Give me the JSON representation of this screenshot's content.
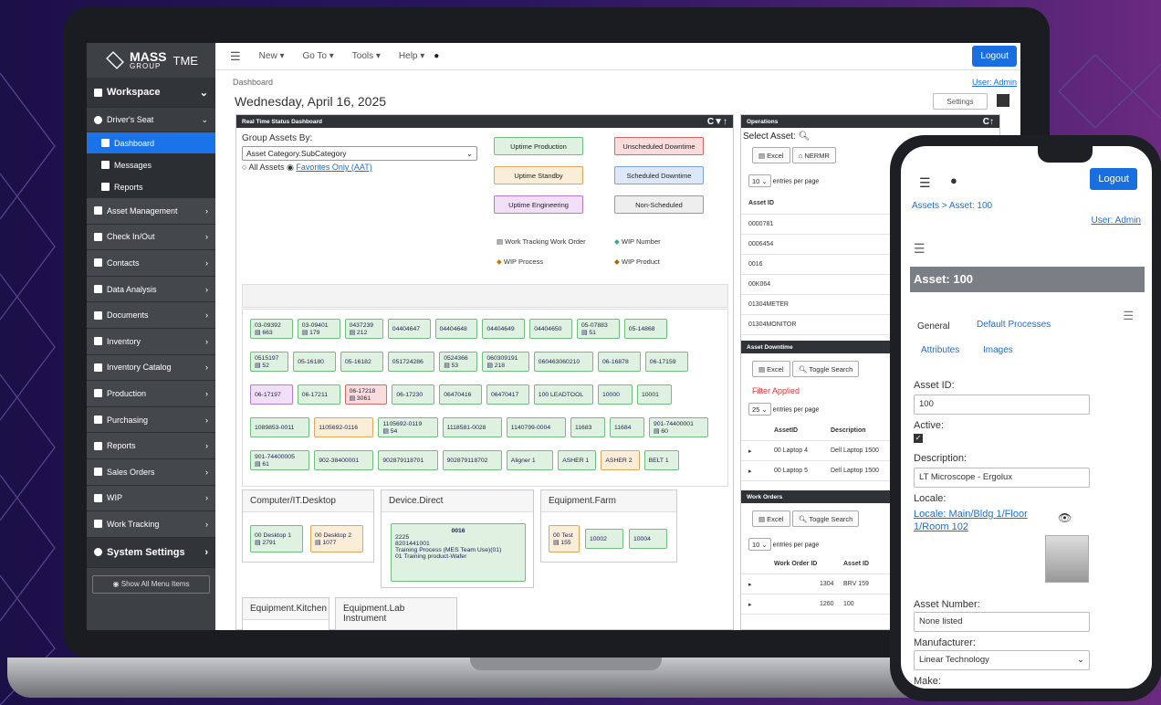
{
  "brand": {
    "name": "MASS",
    "sub": "GROUP",
    "product": "TME"
  },
  "top": {
    "menu": [
      "New ▾",
      "Go To ▾",
      "Tools ▾",
      "Help ▾"
    ],
    "logout": "Logout",
    "breadcrumb": "Dashboard",
    "user": "User: Admin",
    "date": "Wednesday, April 16, 2025",
    "settings": "Settings"
  },
  "sidebar": {
    "workspace": "Workspace",
    "drivers_seat": "Driver's Seat",
    "subs": [
      "Dashboard",
      "Messages",
      "Reports"
    ],
    "items": [
      "Asset Management",
      "Check In/Out",
      "Contacts",
      "Data Analysis",
      "Documents",
      "Inventory",
      "Inventory Catalog",
      "Production",
      "Purchasing",
      "Reports",
      "Sales Orders",
      "WIP",
      "Work Tracking"
    ],
    "system": "System Settings",
    "show_all": "Show All Menu Items"
  },
  "rts": {
    "title": "Real Time Status Dashboard",
    "group_label": "Group Assets By:",
    "group_value": "Asset Category.SubCategory",
    "all_assets": "All Assets",
    "favorites": "Favorites Only (AAT)",
    "legend": [
      "Uptime Production",
      "Unscheduled Downtime",
      "Uptime Standby",
      "Scheduled Downtime",
      "Uptime Engineering",
      "Non-Scheduled"
    ],
    "legend2": [
      "Work Tracking Work Order",
      "WIP Number",
      "WIP Process",
      "WIP Product"
    ],
    "tiles": [
      [
        "03-09392",
        "663"
      ],
      [
        "03-09401",
        "179"
      ],
      [
        "0437239",
        "212"
      ],
      [
        "04404647",
        ""
      ],
      [
        "04404648",
        ""
      ],
      [
        "04404649",
        ""
      ],
      [
        "04404650",
        ""
      ],
      [
        "05-07883",
        "51"
      ],
      [
        "05-14868",
        ""
      ],
      [
        "0515197",
        "52"
      ],
      [
        "05-16180",
        ""
      ],
      [
        "05-16182",
        ""
      ],
      [
        "051724286",
        ""
      ],
      [
        "0524366",
        "53"
      ],
      [
        "060309191",
        "218"
      ],
      [
        "060463060210",
        ""
      ],
      [
        "06-16878",
        ""
      ],
      [
        "06-17159",
        ""
      ],
      [
        "06-17197",
        ""
      ],
      [
        "06-17211",
        ""
      ],
      [
        "06-17218",
        "3061"
      ],
      [
        "06-17230",
        ""
      ],
      [
        "06470416",
        ""
      ],
      [
        "06470417",
        ""
      ],
      [
        "100 LEADTOOL",
        ""
      ],
      [
        "10000",
        ""
      ],
      [
        "10001",
        ""
      ],
      [
        "1089853-0011",
        ""
      ],
      [
        "1105692-0116",
        ""
      ],
      [
        "1105692-0119",
        "54"
      ],
      [
        "1118581-0028",
        ""
      ],
      [
        "1140799-0004",
        ""
      ],
      [
        "11683",
        ""
      ],
      [
        "11684",
        ""
      ],
      [
        "901-74400001",
        "60"
      ],
      [
        "901-74400005",
        "61"
      ],
      [
        "902-38400001",
        ""
      ],
      [
        "902879118701",
        ""
      ],
      [
        "902879118702",
        ""
      ],
      [
        "Aligner 1",
        ""
      ],
      [
        "ASHER 1",
        ""
      ],
      [
        "ASHER 2",
        ""
      ],
      [
        "BELT 1",
        ""
      ]
    ],
    "groups": [
      "Computer/IT.Desktop",
      "Device.Direct",
      "Equipment.Farm",
      "Equipment.Kitchen",
      "Equipment.Lab Instrument"
    ],
    "g1": [
      [
        "00 Desktop 1",
        "2791"
      ],
      [
        "00 Desktop 2",
        "1077"
      ]
    ],
    "g2": {
      "name": "0016",
      "lines": [
        "2225",
        "8201441001",
        "Training Process (MES Team Use)(01)",
        "01 Training product-Wafer"
      ]
    },
    "g3": [
      [
        "00 Test",
        "155"
      ],
      [
        "10002",
        ""
      ],
      [
        "10004",
        ""
      ]
    ]
  },
  "ops": {
    "title": "Operations",
    "select_asset": "Select Asset:",
    "excel": "Excel",
    "nermr": "NERMR",
    "entries": "entries per page",
    "per_page": "10",
    "asset_id": "Asset ID",
    "assets": [
      "0000781",
      "0006454",
      "0016",
      "00K064",
      "01304METER",
      "01304MONITOR"
    ],
    "downtime_title": "Asset Downtime",
    "toggle": "Toggle Search",
    "filter": "Filter Applied",
    "per_page2": "25",
    "cols": [
      "AssetID",
      "Description"
    ],
    "dt_rows": [
      [
        "00 Laptop 4",
        "Dell Laptop 1500"
      ],
      [
        "00 Laptop 5",
        "Dell Laptop 1500"
      ]
    ],
    "wo_title": "Work Orders",
    "wo_cols": [
      "Work Order ID",
      "Asset ID"
    ],
    "wo_rows": [
      [
        "1304",
        "BRV 159"
      ],
      [
        "1260",
        "100"
      ]
    ]
  },
  "phone": {
    "logout": "Logout",
    "crumb": "Assets > Asset: 100",
    "user": "User: Admin",
    "header": "Asset: 100",
    "tabs": [
      "General",
      "Default Processes",
      "Attributes",
      "Images"
    ],
    "asset_id_label": "Asset ID:",
    "asset_id": "100",
    "active_label": "Active:",
    "desc_label": "Description:",
    "desc": "LT Microscope - Ergolux",
    "locale_label": "Locale:",
    "locale": "Locale: Main/Bldg 1/Floor 1/Room 102",
    "asset_num_label": "Asset Number:",
    "asset_num": "None listed",
    "mfr_label": "Manufacturer:",
    "mfr": "Linear Technology",
    "make_label": "Make:"
  }
}
